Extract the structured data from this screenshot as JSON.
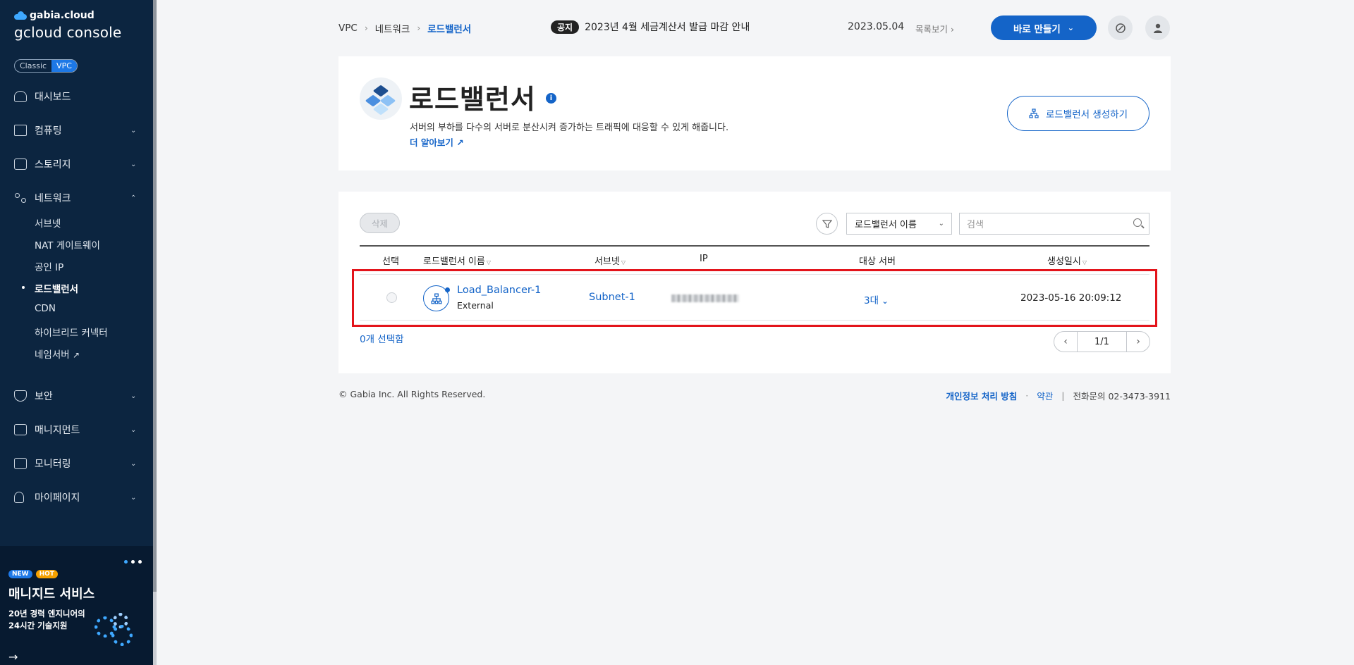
{
  "brand": {
    "small": "gabia.cloud",
    "big": "gcloud console"
  },
  "env": {
    "classic": "Classic",
    "vpc": "VPC"
  },
  "nav": {
    "dashboard": "대시보드",
    "compute": "컴퓨팅",
    "storage": "스토리지",
    "network": "네트워크",
    "network_sub": [
      "서브넷",
      "NAT 게이트웨이",
      "공인 IP",
      "로드밸런서",
      "CDN",
      "하이브리드 커넥터",
      "네임서버"
    ],
    "security": "보안",
    "management": "매니지먼트",
    "monitoring": "모니터링",
    "mypage": "마이페이지"
  },
  "banner": {
    "badge_new": "NEW",
    "badge_hot": "HOT",
    "title": "매니지드 서비스",
    "subtitle": "20년 경력 엔지니어의 24시간 기술지원"
  },
  "header": {
    "breadcrumb": [
      "VPC",
      "네트워크",
      "로드밸런서"
    ],
    "notice_tag": "공지",
    "notice_text": "2023년 4월 세금계산서 발급 마감 안내",
    "date": "2023.05.04",
    "list_view": "목록보기",
    "make_button": "바로 만들기"
  },
  "page": {
    "title": "로드밸런서",
    "description": "서버의 부하를 다수의 서버로 분산시켜 증가하는 트래픽에 대응할 수 있게 해줍니다.",
    "learn_more": "더 알아보기",
    "create_button": "로드밸런서 생성하기"
  },
  "toolbar": {
    "delete": "삭제",
    "filter_select": "로드밸런서 이름",
    "search_placeholder": "검색"
  },
  "table": {
    "headers": {
      "select": "선택",
      "name": "로드밸런서 이름",
      "subnet": "서브넷",
      "ip": "IP",
      "targets": "대상 서버",
      "created": "생성일시"
    },
    "rows": [
      {
        "name": "Load_Balancer-1",
        "type": "External",
        "subnet": "Subnet-1",
        "targets": "3대",
        "created": "2023-05-16 20:09:12"
      }
    ],
    "selected_count": "0개 선택함",
    "page": "1/1"
  },
  "footer": {
    "copyright": "© Gabia Inc. All Rights Reserved.",
    "privacy": "개인정보 처리 방침",
    "terms": "약관",
    "phone": "전화문의 02-3473-3911"
  },
  "colors": {
    "accent": "#1464c8",
    "sidebar": "#0c2540",
    "highlight": "#e3141b"
  }
}
